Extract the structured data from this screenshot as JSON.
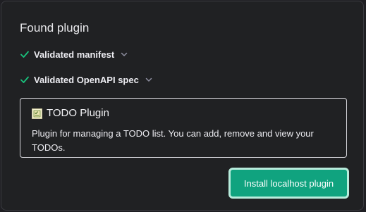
{
  "dialog": {
    "title": "Found plugin",
    "checks": [
      {
        "label": "Validated manifest",
        "icon": "check-icon",
        "status_color": "#19c37d"
      },
      {
        "label": "Validated OpenAPI spec",
        "icon": "check-icon",
        "status_color": "#19c37d"
      }
    ],
    "plugin": {
      "name": "TODO Plugin",
      "logo_icon": "todo-logo-icon",
      "description": "Plugin for managing a TODO list. You can add, remove and view your TODOs."
    },
    "install_button": {
      "label": "Install localhost plugin",
      "color": "#10a37f"
    }
  }
}
